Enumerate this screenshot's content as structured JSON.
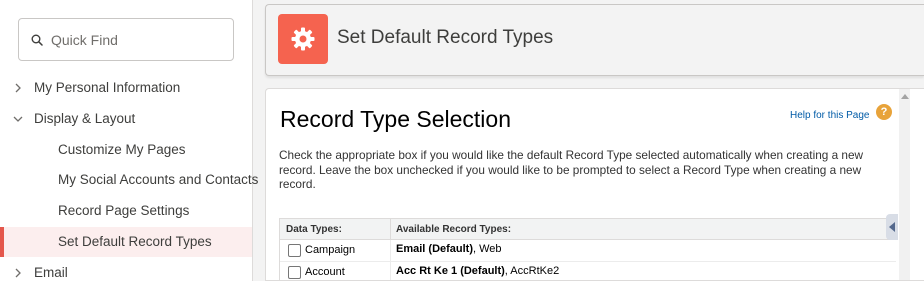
{
  "sidebar": {
    "search": {
      "placeholder": "Quick Find",
      "value": ""
    },
    "items": [
      {
        "label": "My Personal Information"
      },
      {
        "label": "Display & Layout"
      },
      {
        "label": "Customize My Pages"
      },
      {
        "label": "My Social Accounts and Contacts"
      },
      {
        "label": "Record Page Settings"
      },
      {
        "label": "Set Default Record Types"
      },
      {
        "label": "Email"
      }
    ]
  },
  "header": {
    "title": "Set Default Record Types",
    "icon": "gear-icon"
  },
  "main": {
    "heading": "Record Type Selection",
    "help_link": "Help for this Page",
    "help_icon": "?",
    "description": "Check the appropriate box if you would like the default Record Type selected automatically when creating a new record. Leave the box unchecked if you would like to be prompted to select a Record Type when creating a new record.",
    "table": {
      "headers": [
        "Data Types:",
        "Available Record Types:"
      ],
      "rows": [
        {
          "name": "Campaign",
          "default_type": "Email (Default)",
          "others": ", Web",
          "checked": false
        },
        {
          "name": "Account",
          "default_type": "Acc Rt Ke 1 (Default)",
          "others": ", AccRtKe2",
          "checked": false
        }
      ]
    }
  },
  "colors": {
    "accent": "#f5634f",
    "selected_border": "#e4574c",
    "selected_bg": "#fceeee",
    "link": "#015ba7"
  }
}
